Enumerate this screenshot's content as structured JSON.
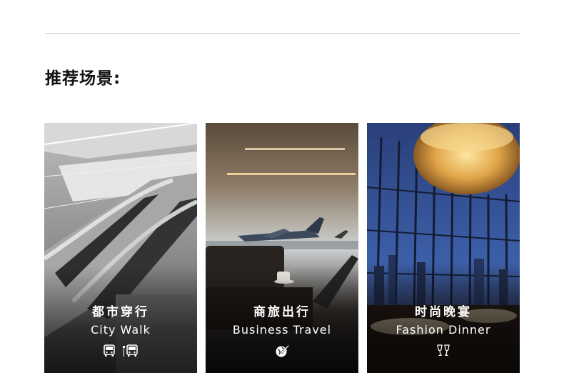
{
  "section": {
    "title": "推荐场景:"
  },
  "cards": [
    {
      "zh": "都市穿行",
      "en": "City Walk",
      "icons": [
        "bus-icon",
        "bus-stop-icon"
      ]
    },
    {
      "zh": "商旅出行",
      "en": "Business Travel",
      "icons": [
        "globe-plane-icon"
      ]
    },
    {
      "zh": "时尚晚宴",
      "en": "Fashion Dinner",
      "icons": [
        "wine-glasses-icon"
      ]
    }
  ]
}
